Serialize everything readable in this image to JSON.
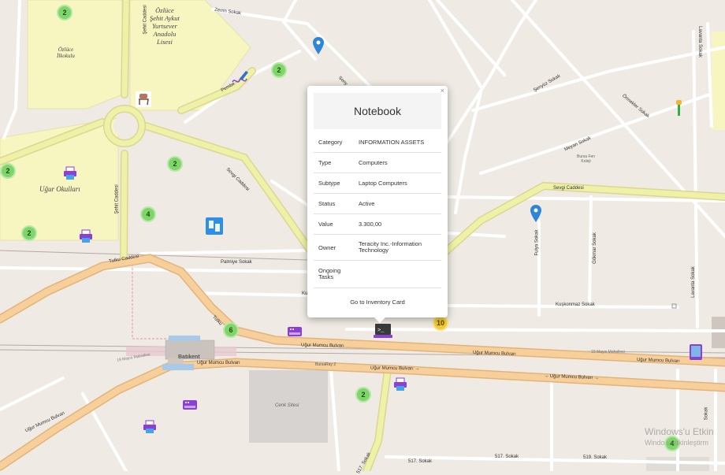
{
  "streets": {
    "zerrin": "Zerrin Sokak",
    "seny": "Seny",
    "senyuz": "Şenyüz Sokak",
    "ormekler": "Örmekler Sokak",
    "lavanta_top": "Lavanta Sokak",
    "lavanta_right": "Lavanta Sokak",
    "meyan": "Meyan Sokak",
    "pembe": "Pembe",
    "sevgi_diag": "Sevgi Caddesi",
    "sevgi_right": "Sevgi Caddesi",
    "fulya": "Fulya Sokak",
    "gokmar": "Gökmar Sokak",
    "palmiye": "Palmiye Sokak",
    "tutku_left": "Tutku Caddesi",
    "tutku_mid": "Tutku",
    "kus": "Ku",
    "kuskonmaz": "Kuşkonmaz Sokak",
    "ugur_mid_top": "Uğur Mumcu Bulvarı",
    "ugur_mid_top_arrow": "→",
    "ugur_right_top": "Uğur Mumcu Bulvarı",
    "ugur_right_top_arrow": "→",
    "ugur_left_bot": "Uğur Mumcu Bulvarı",
    "ugur_mid_bot": "Uğur Mumcu Bulvarı →",
    "ugur_right_bot": "→ Uğur Mumcu Bulvarı →",
    "ugur_far_left": "Uğur Mumcu Bulvarı",
    "ugur_left_small": "19 Mayıs Mahallesi",
    "ugur_right_small": "19 Mayıs Mahallesi",
    "bursaray": "BursaRay 2",
    "batikent": "Batıkent",
    "sokak517a": "517. Sokak",
    "sokak517b": "517. Sokak",
    "sokak519": "519. Sokak",
    "sokak_far_right": "Sokak",
    "sehit_caddesi": "Şehit Caddesi",
    "bursa_fen": "Bursa Fen\nKoleji",
    "cenk_sitesi": "Cenk Sitesi"
  },
  "places": {
    "ozluce_ilkokulu": "Özlüce\nİlkokulu",
    "ozluce_lisesi": "Özlüce\nŞehit Aykut\nYurtsever\nAnadolu\nLisesi",
    "ugur_okullari": "Uğur Okulları"
  },
  "clusters": [
    "2",
    "2",
    "2",
    "2",
    "4",
    "2",
    "6",
    "2",
    "10",
    "4"
  ],
  "popup": {
    "title": "Notebook",
    "close": "×",
    "rows": [
      {
        "key": "Category",
        "value": "INFORMATION ASSETS"
      },
      {
        "key": "Type",
        "value": "Computers"
      },
      {
        "key": "Subtype",
        "value": "Laptop Computers"
      },
      {
        "key": "Status",
        "value": "Active"
      },
      {
        "key": "Value",
        "value": "3.300,00"
      },
      {
        "key": "Owner",
        "value": "Teracity Inc.-Information Technology"
      },
      {
        "key": "Ongoing Tasks",
        "value": ""
      }
    ],
    "link": "Go to Inventory Card"
  },
  "watermark": {
    "line1": "Windows'u Etkin",
    "line2": "Windo   u etkinleştirm"
  },
  "colors": {
    "map_bg": "#efeae3",
    "park": "#f8f6c0",
    "major_road": "#f7cf9b",
    "secondary_road": "#eef2a8",
    "cluster_green": "#7fd46a",
    "cluster_yellow": "#f2cc2c",
    "pin_blue": "#2f86d9",
    "asset_purple": "#8a3fd6"
  },
  "icons": [
    "map-pin-icon",
    "printer-icon",
    "server-icon",
    "terminal-icon",
    "tablet-icon",
    "dashboard-icon",
    "chair-icon",
    "pen-icon",
    "traffic-light-icon"
  ]
}
